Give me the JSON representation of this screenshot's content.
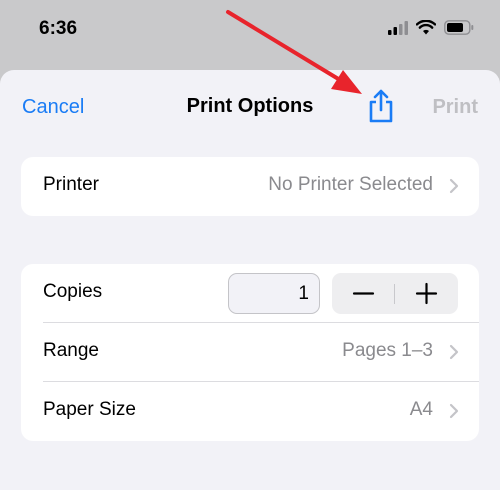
{
  "status": {
    "time": "6:36"
  },
  "nav": {
    "cancel": "Cancel",
    "title": "Print Options",
    "print": "Print"
  },
  "printer_group": {
    "printer": {
      "label": "Printer",
      "value": "No Printer Selected"
    }
  },
  "options_group": {
    "copies": {
      "label": "Copies",
      "value": "1",
      "minus": "−",
      "plus": "+"
    },
    "range": {
      "label": "Range",
      "value": "Pages 1–3"
    },
    "paper_size": {
      "label": "Paper Size",
      "value": "A4"
    }
  },
  "colors": {
    "accent": "#1a7cf5",
    "arrow": "#e8242c",
    "disabled": "#bfbfc3"
  }
}
